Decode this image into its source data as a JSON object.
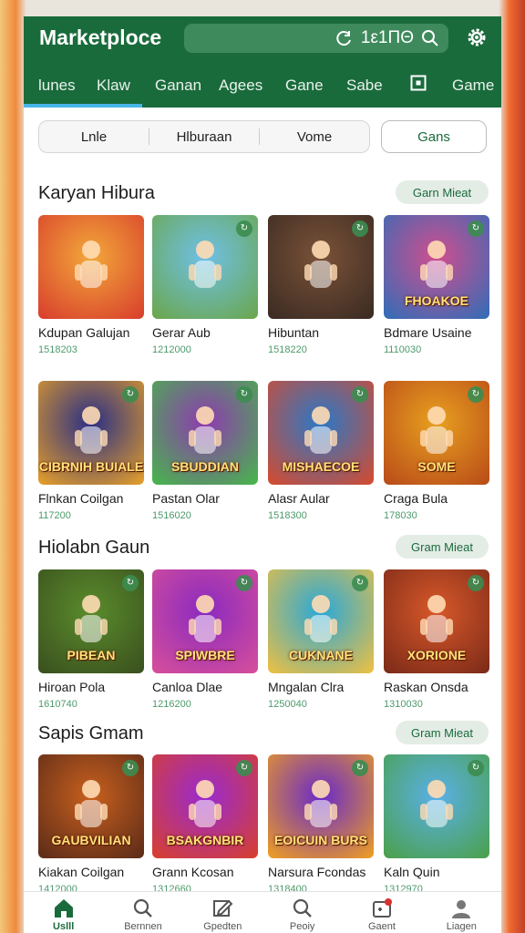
{
  "header": {
    "title": "Marketploce",
    "search_text": "1ε1ΠΘ",
    "tabs": [
      "lunes",
      "Klaw",
      "Ganan",
      "Agees",
      "Gane",
      "Sabe",
      "",
      "Game"
    ]
  },
  "filters": {
    "items": [
      "Lnle",
      "Hlburaan",
      "Vome"
    ],
    "active": "Gans"
  },
  "sections": [
    {
      "title": "Karyan Hibura",
      "more": "Garn Mieat",
      "tiles": [
        {
          "name": "Kdupan Galujan",
          "count": "1518203",
          "logo": "",
          "colors": [
            "#f2a83a",
            "#d83d2c"
          ]
        },
        {
          "name": "Gerar Aub",
          "count": "1212000",
          "logo": "",
          "colors": [
            "#6fc0e8",
            "#6aa64a"
          ]
        },
        {
          "name": "Hibuntan",
          "count": "1518220",
          "logo": "",
          "colors": [
            "#7a5238",
            "#3a2a22"
          ]
        },
        {
          "name": "Bdmare Usaine",
          "count": "1110030",
          "logo": "FHOAKOE",
          "colors": [
            "#d04e8e",
            "#2f6db8"
          ]
        }
      ]
    },
    {
      "title": "",
      "more": "",
      "tiles": [
        {
          "name": "Flnkan Coilgan",
          "count": "117200",
          "logo": "CIBRNIH BUIALE",
          "colors": [
            "#2a2f86",
            "#e8a028"
          ]
        },
        {
          "name": "Pastan Olar",
          "count": "1516020",
          "logo": "SBUDDIAN",
          "colors": [
            "#8e3ab0",
            "#46b84a"
          ]
        },
        {
          "name": "Alasr Aular",
          "count": "1518300",
          "logo": "MISHAECOE",
          "colors": [
            "#2a78c8",
            "#d84a2c"
          ]
        },
        {
          "name": "Craga Bula",
          "count": "178030",
          "logo": "SOME",
          "colors": [
            "#e8a020",
            "#b84a18"
          ]
        }
      ]
    },
    {
      "title": "Hiolabn Gaun",
      "more": "Gram Mieat",
      "tiles": [
        {
          "name": "Hiroan Pola",
          "count": "1610740",
          "logo": "PIBEAN",
          "colors": [
            "#5a8c2c",
            "#3a4f1e"
          ]
        },
        {
          "name": "Canloa Dlae",
          "count": "1216200",
          "logo": "SPIWBRE",
          "colors": [
            "#8a2ac0",
            "#d84f9a"
          ]
        },
        {
          "name": "Mngalan Clra",
          "count": "1250040",
          "logo": "CUKNANE",
          "colors": [
            "#2aa8d8",
            "#f0c040"
          ]
        },
        {
          "name": "Raskan Onsda",
          "count": "1310030",
          "logo": "XORIONE",
          "colors": [
            "#d8582a",
            "#7a2a18"
          ]
        }
      ]
    },
    {
      "title": "Sapis Gmam",
      "more": "Gram Mieat",
      "tiles": [
        {
          "name": "Kiakan Coilgan",
          "count": "1412000",
          "logo": "GAUBVILIAN",
          "colors": [
            "#c8601e",
            "#5a2a18"
          ]
        },
        {
          "name": "Grann Kcosan",
          "count": "1312660",
          "logo": "BSAKGNBIR",
          "colors": [
            "#9a2ad0",
            "#d8402a"
          ]
        },
        {
          "name": "Narsura Fcondas",
          "count": "1318400",
          "logo": "EOICUIN BURS",
          "colors": [
            "#6a2ac8",
            "#f0a020"
          ]
        },
        {
          "name": "Kaln Quin",
          "count": "1312970",
          "logo": "",
          "colors": [
            "#5ab0e8",
            "#4aa048"
          ]
        }
      ]
    }
  ],
  "bottom_nav": [
    {
      "label": "Uslll",
      "icon": "home-icon",
      "active": true
    },
    {
      "label": "Bernnen",
      "icon": "search-icon",
      "active": false
    },
    {
      "label": "Gpedten",
      "icon": "edit-icon",
      "active": false
    },
    {
      "label": "Peoiy",
      "icon": "magnifier-icon",
      "active": false
    },
    {
      "label": "Gaent",
      "icon": "gamepad-icon",
      "active": false
    },
    {
      "label": "Liagen",
      "icon": "profile-icon",
      "active": false
    }
  ],
  "colors": {
    "brand": "#1a6b3c",
    "accent": "#47b6e8"
  }
}
